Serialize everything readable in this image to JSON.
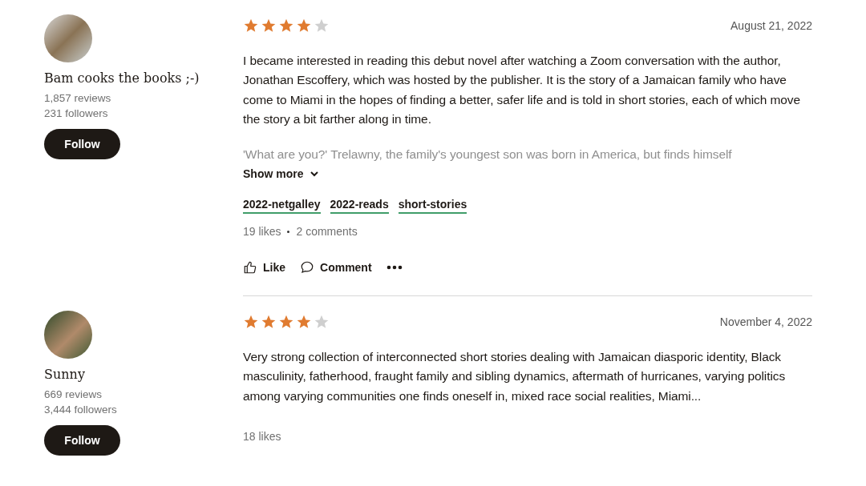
{
  "reviews": [
    {
      "reviewer": {
        "name": "Bam cooks the books ;-)",
        "reviews": "1,857 reviews",
        "followers": "231 followers",
        "follow_label": "Follow"
      },
      "stars": 4,
      "date": "August 21, 2022",
      "text": "I became interested in reading this debut novel after watching a Zoom conversation with the author, Jonathan Escoffery, which was hosted by the publisher. It is the story of a Jamaican family who have come to Miami in the hopes of finding a better, safer life and is told in short stories, each of which move the story a bit farther along in time.",
      "faded_text": "'What are you?' Trelawny, the family's youngest son was born in America, but finds himself",
      "show_more": "Show more",
      "tags": [
        "2022-netgalley",
        "2022-reads",
        "short-stories"
      ],
      "likes": "19 likes",
      "comments": "2 comments",
      "actions": {
        "like": "Like",
        "comment": "Comment"
      }
    },
    {
      "reviewer": {
        "name": "Sunny",
        "reviews": "669 reviews",
        "followers": "3,444 followers",
        "follow_label": "Follow"
      },
      "stars": 4,
      "date": "November 4, 2022",
      "text": "Very strong collection of interconnected short stories dealing with Jamaican diasporic identity, Black masculinity, fatherhood, fraught family and sibling dynamics, aftermath of hurricanes, varying politics among varying communities one finds oneself in, mixed race social realities, Miami...",
      "likes": "18 likes"
    }
  ]
}
